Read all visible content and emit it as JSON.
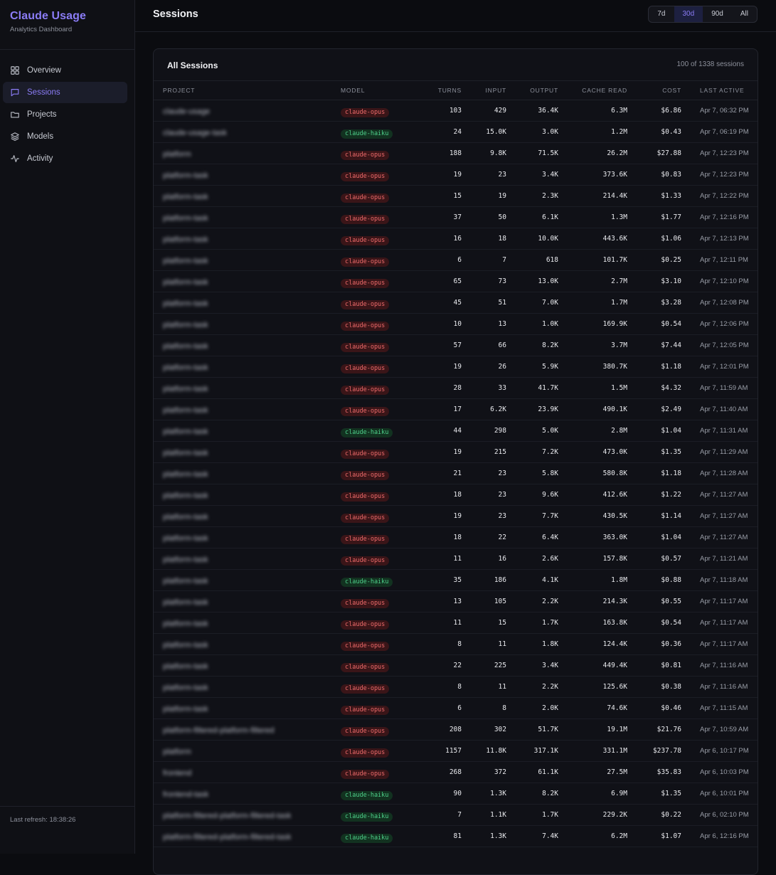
{
  "app": {
    "title": "Claude Usage",
    "subtitle": "Analytics Dashboard"
  },
  "nav": [
    {
      "label": "Overview",
      "icon": "grid-icon",
      "active": false
    },
    {
      "label": "Sessions",
      "icon": "chat-icon",
      "active": true
    },
    {
      "label": "Projects",
      "icon": "folder-icon",
      "active": false
    },
    {
      "label": "Models",
      "icon": "layers-icon",
      "active": false
    },
    {
      "label": "Activity",
      "icon": "activity-icon",
      "active": false
    }
  ],
  "footer": {
    "last_refresh": "Last refresh: 18:38:26"
  },
  "header": {
    "title": "Sessions",
    "ranges": [
      {
        "label": "7d",
        "active": false
      },
      {
        "label": "30d",
        "active": true
      },
      {
        "label": "90d",
        "active": false
      },
      {
        "label": "All",
        "active": false
      }
    ]
  },
  "sessions": {
    "title": "All Sessions",
    "count_label": "100 of 1338 sessions",
    "columns": [
      "Project",
      "Model",
      "Turns",
      "Input",
      "Output",
      "Cache Read",
      "Cost",
      "Last Active"
    ],
    "rows": [
      {
        "project": "claude-usage",
        "model": "claude-opus",
        "turns": "103",
        "input": "429",
        "output": "36.4K",
        "cache": "6.3M",
        "cost": "$6.86",
        "last": "Apr 7, 06:32 PM"
      },
      {
        "project": "claude-usage-task",
        "model": "claude-haiku",
        "turns": "24",
        "input": "15.0K",
        "output": "3.0K",
        "cache": "1.2M",
        "cost": "$0.43",
        "last": "Apr 7, 06:19 PM"
      },
      {
        "project": "platform",
        "model": "claude-opus",
        "turns": "188",
        "input": "9.8K",
        "output": "71.5K",
        "cache": "26.2M",
        "cost": "$27.88",
        "last": "Apr 7, 12:23 PM"
      },
      {
        "project": "platform-task",
        "model": "claude-opus",
        "turns": "19",
        "input": "23",
        "output": "3.4K",
        "cache": "373.6K",
        "cost": "$0.83",
        "last": "Apr 7, 12:23 PM"
      },
      {
        "project": "platform-task",
        "model": "claude-opus",
        "turns": "15",
        "input": "19",
        "output": "2.3K",
        "cache": "214.4K",
        "cost": "$1.33",
        "last": "Apr 7, 12:22 PM"
      },
      {
        "project": "platform-task",
        "model": "claude-opus",
        "turns": "37",
        "input": "50",
        "output": "6.1K",
        "cache": "1.3M",
        "cost": "$1.77",
        "last": "Apr 7, 12:16 PM"
      },
      {
        "project": "platform-task",
        "model": "claude-opus",
        "turns": "16",
        "input": "18",
        "output": "10.0K",
        "cache": "443.6K",
        "cost": "$1.06",
        "last": "Apr 7, 12:13 PM"
      },
      {
        "project": "platform-task",
        "model": "claude-opus",
        "turns": "6",
        "input": "7",
        "output": "618",
        "cache": "101.7K",
        "cost": "$0.25",
        "last": "Apr 7, 12:11 PM"
      },
      {
        "project": "platform-task",
        "model": "claude-opus",
        "turns": "65",
        "input": "73",
        "output": "13.0K",
        "cache": "2.7M",
        "cost": "$3.10",
        "last": "Apr 7, 12:10 PM"
      },
      {
        "project": "platform-task",
        "model": "claude-opus",
        "turns": "45",
        "input": "51",
        "output": "7.0K",
        "cache": "1.7M",
        "cost": "$3.28",
        "last": "Apr 7, 12:08 PM"
      },
      {
        "project": "platform-task",
        "model": "claude-opus",
        "turns": "10",
        "input": "13",
        "output": "1.0K",
        "cache": "169.9K",
        "cost": "$0.54",
        "last": "Apr 7, 12:06 PM"
      },
      {
        "project": "platform-task",
        "model": "claude-opus",
        "turns": "57",
        "input": "66",
        "output": "8.2K",
        "cache": "3.7M",
        "cost": "$7.44",
        "last": "Apr 7, 12:05 PM"
      },
      {
        "project": "platform-task",
        "model": "claude-opus",
        "turns": "19",
        "input": "26",
        "output": "5.9K",
        "cache": "380.7K",
        "cost": "$1.18",
        "last": "Apr 7, 12:01 PM"
      },
      {
        "project": "platform-task",
        "model": "claude-opus",
        "turns": "28",
        "input": "33",
        "output": "41.7K",
        "cache": "1.5M",
        "cost": "$4.32",
        "last": "Apr 7, 11:59 AM"
      },
      {
        "project": "platform-task",
        "model": "claude-opus",
        "turns": "17",
        "input": "6.2K",
        "output": "23.9K",
        "cache": "490.1K",
        "cost": "$2.49",
        "last": "Apr 7, 11:40 AM"
      },
      {
        "project": "platform-task",
        "model": "claude-haiku",
        "turns": "44",
        "input": "298",
        "output": "5.0K",
        "cache": "2.8M",
        "cost": "$1.04",
        "last": "Apr 7, 11:31 AM"
      },
      {
        "project": "platform-task",
        "model": "claude-opus",
        "turns": "19",
        "input": "215",
        "output": "7.2K",
        "cache": "473.0K",
        "cost": "$1.35",
        "last": "Apr 7, 11:29 AM"
      },
      {
        "project": "platform-task",
        "model": "claude-opus",
        "turns": "21",
        "input": "23",
        "output": "5.8K",
        "cache": "580.8K",
        "cost": "$1.18",
        "last": "Apr 7, 11:28 AM"
      },
      {
        "project": "platform-task",
        "model": "claude-opus",
        "turns": "18",
        "input": "23",
        "output": "9.6K",
        "cache": "412.6K",
        "cost": "$1.22",
        "last": "Apr 7, 11:27 AM"
      },
      {
        "project": "platform-task",
        "model": "claude-opus",
        "turns": "19",
        "input": "23",
        "output": "7.7K",
        "cache": "430.5K",
        "cost": "$1.14",
        "last": "Apr 7, 11:27 AM"
      },
      {
        "project": "platform-task",
        "model": "claude-opus",
        "turns": "18",
        "input": "22",
        "output": "6.4K",
        "cache": "363.0K",
        "cost": "$1.04",
        "last": "Apr 7, 11:27 AM"
      },
      {
        "project": "platform-task",
        "model": "claude-opus",
        "turns": "11",
        "input": "16",
        "output": "2.6K",
        "cache": "157.8K",
        "cost": "$0.57",
        "last": "Apr 7, 11:21 AM"
      },
      {
        "project": "platform-task",
        "model": "claude-haiku",
        "turns": "35",
        "input": "186",
        "output": "4.1K",
        "cache": "1.8M",
        "cost": "$0.88",
        "last": "Apr 7, 11:18 AM"
      },
      {
        "project": "platform-task",
        "model": "claude-opus",
        "turns": "13",
        "input": "105",
        "output": "2.2K",
        "cache": "214.3K",
        "cost": "$0.55",
        "last": "Apr 7, 11:17 AM"
      },
      {
        "project": "platform-task",
        "model": "claude-opus",
        "turns": "11",
        "input": "15",
        "output": "1.7K",
        "cache": "163.8K",
        "cost": "$0.54",
        "last": "Apr 7, 11:17 AM"
      },
      {
        "project": "platform-task",
        "model": "claude-opus",
        "turns": "8",
        "input": "11",
        "output": "1.8K",
        "cache": "124.4K",
        "cost": "$0.36",
        "last": "Apr 7, 11:17 AM"
      },
      {
        "project": "platform-task",
        "model": "claude-opus",
        "turns": "22",
        "input": "225",
        "output": "3.4K",
        "cache": "449.4K",
        "cost": "$0.81",
        "last": "Apr 7, 11:16 AM"
      },
      {
        "project": "platform-task",
        "model": "claude-opus",
        "turns": "8",
        "input": "11",
        "output": "2.2K",
        "cache": "125.6K",
        "cost": "$0.38",
        "last": "Apr 7, 11:16 AM"
      },
      {
        "project": "platform-task",
        "model": "claude-opus",
        "turns": "6",
        "input": "8",
        "output": "2.0K",
        "cache": "74.6K",
        "cost": "$0.46",
        "last": "Apr 7, 11:15 AM"
      },
      {
        "project": "platform-filtered-platform-filtered",
        "model": "claude-opus",
        "turns": "208",
        "input": "302",
        "output": "51.7K",
        "cache": "19.1M",
        "cost": "$21.76",
        "last": "Apr 7, 10:59 AM"
      },
      {
        "project": "platform",
        "model": "claude-opus",
        "turns": "1157",
        "input": "11.8K",
        "output": "317.1K",
        "cache": "331.1M",
        "cost": "$237.78",
        "last": "Apr 6, 10:17 PM"
      },
      {
        "project": "frontend",
        "model": "claude-opus",
        "turns": "268",
        "input": "372",
        "output": "61.1K",
        "cache": "27.5M",
        "cost": "$35.83",
        "last": "Apr 6, 10:03 PM"
      },
      {
        "project": "frontend-task",
        "model": "claude-haiku",
        "turns": "90",
        "input": "1.3K",
        "output": "8.2K",
        "cache": "6.9M",
        "cost": "$1.35",
        "last": "Apr 6, 10:01 PM"
      },
      {
        "project": "platform-filtered-platform-filtered-task",
        "model": "claude-haiku",
        "turns": "7",
        "input": "1.1K",
        "output": "1.7K",
        "cache": "229.2K",
        "cost": "$0.22",
        "last": "Apr 6, 02:10 PM"
      },
      {
        "project": "platform-filtered-platform-filtered-task",
        "model": "claude-haiku",
        "turns": "81",
        "input": "1.3K",
        "output": "7.4K",
        "cache": "6.2M",
        "cost": "$1.07",
        "last": "Apr 6, 12:16 PM"
      }
    ]
  }
}
